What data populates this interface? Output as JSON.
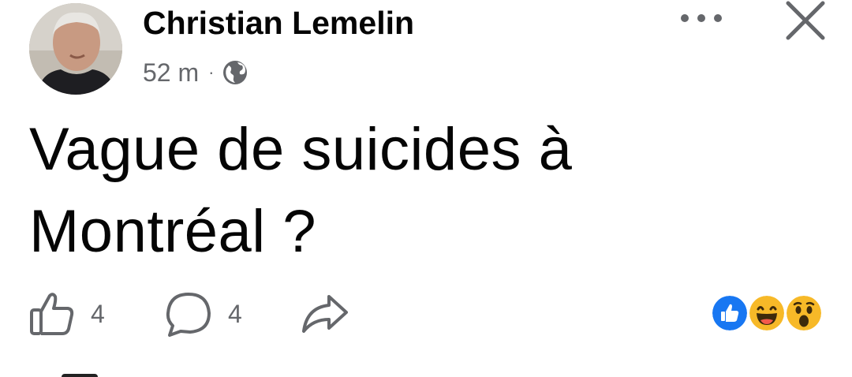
{
  "post": {
    "author": "Christian Lemelin",
    "time": "52 m",
    "separator": "·",
    "visibility_icon": "globe-icon",
    "text": "Vague de suicides à Montréal ?"
  },
  "header_actions": {
    "more_icon": "more-horizontal-icon",
    "close_icon": "close-icon"
  },
  "actions": {
    "like_count": "4",
    "comment_count": "4",
    "share_icon": "share-arrow-icon"
  },
  "reactions": [
    "like",
    "haha",
    "wow"
  ],
  "colors": {
    "text_primary": "#050505",
    "text_secondary": "#65676b",
    "like_blue": "#1877f2",
    "emoji_yellow": "#f7b928"
  }
}
